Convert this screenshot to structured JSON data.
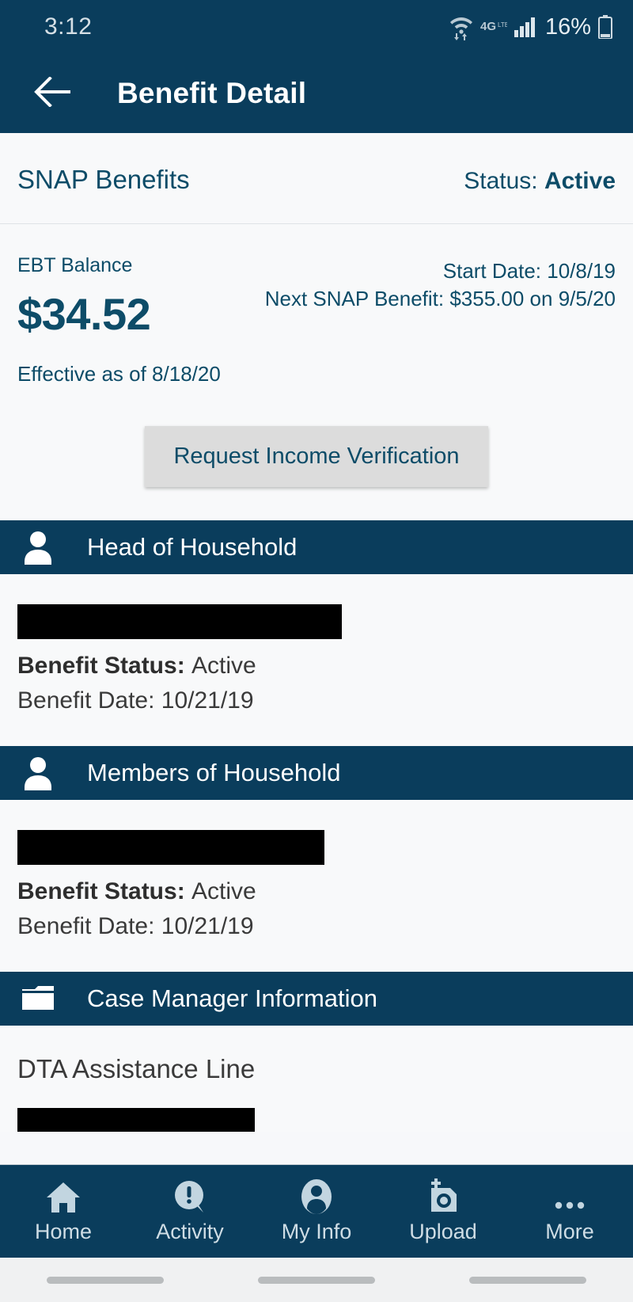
{
  "status_bar": {
    "time": "3:12",
    "battery_percent": "16%",
    "network": "4G LTE",
    "icons": [
      "wifi-data-icon",
      "4glte-icon",
      "signal-bars-icon",
      "battery-icon"
    ]
  },
  "app_bar": {
    "back_icon": "back-arrow-icon",
    "title": "Benefit Detail"
  },
  "benefit_summary": {
    "program_title": "SNAP Benefits",
    "status_label": "Status: ",
    "status_value": "Active",
    "ebt_balance_label": "EBT Balance",
    "ebt_balance_amount": "$34.52",
    "effective_text": "Effective as of 8/18/20",
    "start_date": "Start Date: 10/8/19",
    "next_benefit": "Next SNAP Benefit: $355.00 on 9/5/20",
    "request_button": "Request Income Verification"
  },
  "head_of_household": {
    "section_title": "Head of Household",
    "section_icon": "person-icon",
    "name_redacted": "",
    "benefit_status_label": "Benefit Status: ",
    "benefit_status_value": "Active",
    "benefit_date": "Benefit Date: 10/21/19"
  },
  "members_of_household": {
    "section_title": "Members of Household",
    "section_icon": "person-icon",
    "name_redacted": "",
    "benefit_status_label": "Benefit Status: ",
    "benefit_status_value": "Active",
    "benefit_date": "Benefit Date: 10/21/19"
  },
  "case_manager": {
    "section_title": "Case Manager Information",
    "section_icon": "folder-icon",
    "name": "DTA Assistance Line",
    "phone_redacted": ""
  },
  "bottom_nav": [
    {
      "label": "Home",
      "icon": "home-icon"
    },
    {
      "label": "Activity",
      "icon": "alert-bubble-icon"
    },
    {
      "label": "My Info",
      "icon": "person-circle-icon"
    },
    {
      "label": "Upload",
      "icon": "camera-plus-icon"
    },
    {
      "label": "More",
      "icon": "ellipsis-icon"
    }
  ],
  "colors": {
    "primary_dark_blue": "#0a3d5c",
    "accent_text_blue": "#0d4c68",
    "page_background": "#f8f9fa",
    "nav_icon": "#c2d5e0",
    "button_gray": "#dcdcdc"
  }
}
